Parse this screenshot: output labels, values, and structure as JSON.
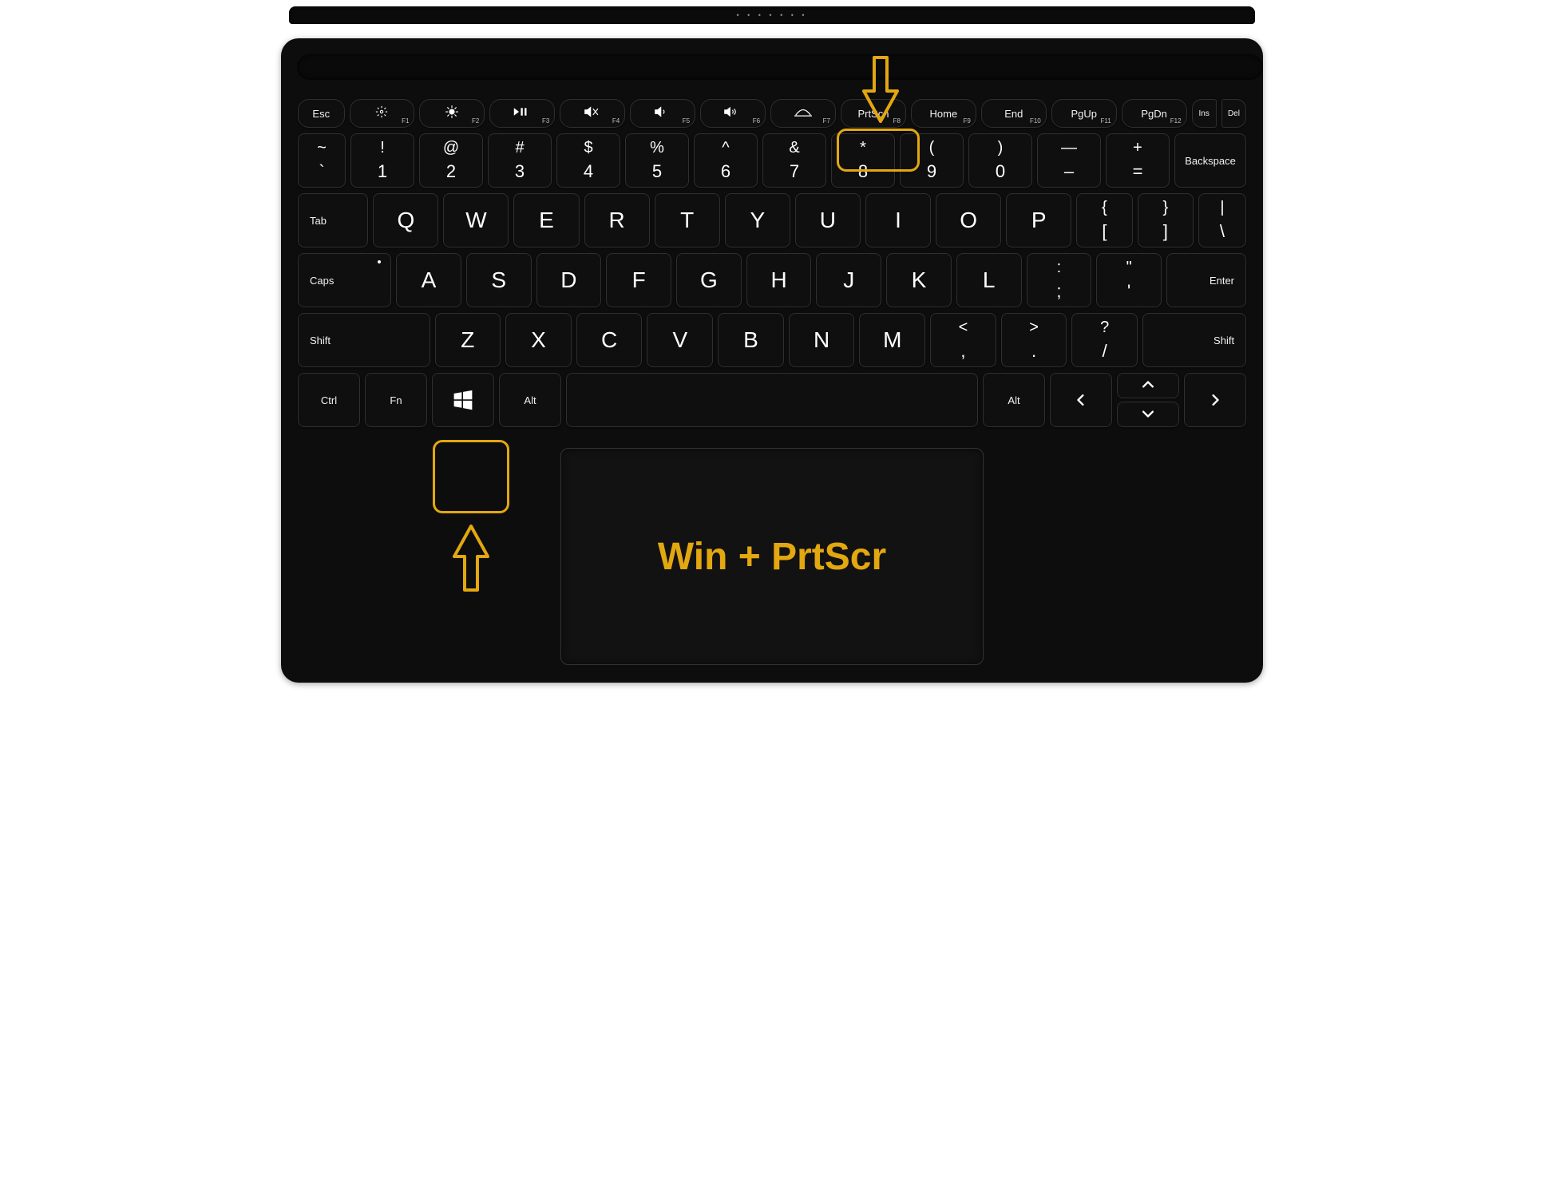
{
  "overlay_caption": "Win + PrtScr",
  "hinge_dots": "• • • • • • •",
  "function_row": [
    {
      "label": "Esc",
      "sub": "",
      "name": "key-esc"
    },
    {
      "icon": "brightness-down",
      "sub": "F1",
      "name": "key-f1"
    },
    {
      "icon": "brightness-up",
      "sub": "F2",
      "name": "key-f2"
    },
    {
      "icon": "play-pause",
      "sub": "F3",
      "name": "key-f3"
    },
    {
      "icon": "mute",
      "sub": "F4",
      "name": "key-f4"
    },
    {
      "icon": "vol-down",
      "sub": "F5",
      "name": "key-f5"
    },
    {
      "icon": "vol-up",
      "sub": "F6",
      "name": "key-f6"
    },
    {
      "icon": "kb-bright",
      "sub": "F7",
      "name": "key-f7"
    },
    {
      "label": "PrtScn",
      "sub": "F8",
      "name": "key-prtscn"
    },
    {
      "label": "Home",
      "sub": "F9",
      "name": "key-home"
    },
    {
      "label": "End",
      "sub": "F10",
      "name": "key-end"
    },
    {
      "label": "PgUp",
      "sub": "F11",
      "name": "key-pgup"
    },
    {
      "label": "PgDn",
      "sub": "F12",
      "name": "key-pgdn"
    }
  ],
  "function_tail": [
    {
      "label": "Ins",
      "name": "key-ins"
    },
    {
      "label": "Del",
      "name": "key-del"
    }
  ],
  "number_row": [
    {
      "top": "~",
      "bottom": "`",
      "name": "key-backtick"
    },
    {
      "top": "!",
      "bottom": "1",
      "name": "key-1"
    },
    {
      "top": "@",
      "bottom": "2",
      "name": "key-2"
    },
    {
      "top": "#",
      "bottom": "3",
      "name": "key-3"
    },
    {
      "top": "$",
      "bottom": "4",
      "name": "key-4"
    },
    {
      "top": "%",
      "bottom": "5",
      "name": "key-5"
    },
    {
      "top": "^",
      "bottom": "6",
      "name": "key-6"
    },
    {
      "top": "&",
      "bottom": "7",
      "name": "key-7"
    },
    {
      "top": "*",
      "bottom": "8",
      "name": "key-8"
    },
    {
      "top": "(",
      "bottom": "9",
      "name": "key-9"
    },
    {
      "top": ")",
      "bottom": "0",
      "name": "key-0"
    },
    {
      "top": "—",
      "bottom": "–",
      "name": "key-minus"
    },
    {
      "top": "+",
      "bottom": "=",
      "name": "key-equals"
    }
  ],
  "backspace_label": "Backspace",
  "tab_label": "Tab",
  "qwerty_row": [
    {
      "label": "Q",
      "name": "key-q"
    },
    {
      "label": "W",
      "name": "key-w"
    },
    {
      "label": "E",
      "name": "key-e"
    },
    {
      "label": "R",
      "name": "key-r"
    },
    {
      "label": "T",
      "name": "key-t"
    },
    {
      "label": "Y",
      "name": "key-y"
    },
    {
      "label": "U",
      "name": "key-u"
    },
    {
      "label": "I",
      "name": "key-i"
    },
    {
      "label": "O",
      "name": "key-o"
    },
    {
      "label": "P",
      "name": "key-p"
    }
  ],
  "brackets": [
    {
      "top": "{",
      "bottom": "[",
      "name": "key-lbracket"
    },
    {
      "top": "}",
      "bottom": "]",
      "name": "key-rbracket"
    },
    {
      "top": "|",
      "bottom": "\\",
      "name": "key-backslash"
    }
  ],
  "caps_label": "Caps",
  "asdf_row": [
    {
      "label": "A",
      "name": "key-a"
    },
    {
      "label": "S",
      "name": "key-s"
    },
    {
      "label": "D",
      "name": "key-d"
    },
    {
      "label": "F",
      "name": "key-f"
    },
    {
      "label": "G",
      "name": "key-g"
    },
    {
      "label": "H",
      "name": "key-h"
    },
    {
      "label": "J",
      "name": "key-j"
    },
    {
      "label": "K",
      "name": "key-k"
    },
    {
      "label": "L",
      "name": "key-l"
    }
  ],
  "semi": [
    {
      "top": ":",
      "bottom": ";",
      "name": "key-semicolon"
    },
    {
      "top": "\"",
      "bottom": "'",
      "name": "key-quote"
    }
  ],
  "enter_label": "Enter",
  "shift_label_l": "Shift",
  "shift_label_r": "Shift",
  "zxcv_row": [
    {
      "label": "Z",
      "name": "key-z"
    },
    {
      "label": "X",
      "name": "key-x"
    },
    {
      "label": "C",
      "name": "key-c"
    },
    {
      "label": "V",
      "name": "key-v"
    },
    {
      "label": "B",
      "name": "key-b"
    },
    {
      "label": "N",
      "name": "key-n"
    },
    {
      "label": "M",
      "name": "key-m"
    }
  ],
  "punct": [
    {
      "top": "<",
      "bottom": ",",
      "name": "key-comma"
    },
    {
      "top": ">",
      "bottom": ".",
      "name": "key-period"
    },
    {
      "top": "?",
      "bottom": "/",
      "name": "key-slash"
    }
  ],
  "bottom_row": {
    "ctrl": "Ctrl",
    "fn": "Fn",
    "alt_l": "Alt",
    "alt_r": "Alt",
    "arrow_left": "‹",
    "arrow_right": "›",
    "arrow_up": "︿",
    "arrow_down": "﹀"
  }
}
